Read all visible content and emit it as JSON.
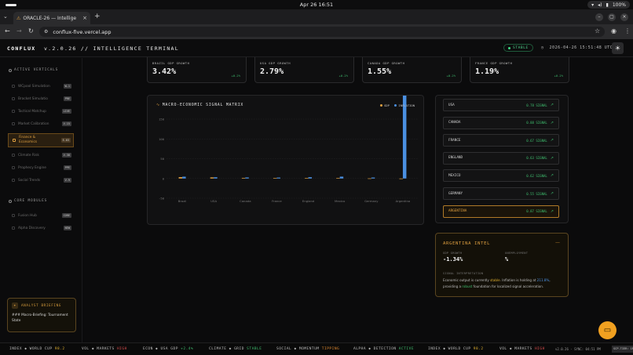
{
  "os": {
    "clock": "Apr 26  16:51",
    "battery": "100%"
  },
  "browser": {
    "tab_title": "ORACLE-26 — Intellige",
    "url": "conflux-five.vercel.app"
  },
  "header": {
    "brand": "CONFLUX",
    "version": "v.2.0.26 // INTELLIGENCE TERMINAL",
    "status": "STABLE",
    "timestamp": "2026-04-26 15:51:48 UTC"
  },
  "sidebar": {
    "active_heading": "ACTIVE VERTICALS",
    "items": [
      {
        "label": "WCpool Simulation",
        "badge": "W-1"
      },
      {
        "label": "Bracket Simulatio",
        "badge": "PRE"
      },
      {
        "label": "Tactical Matchup",
        "badge": "LIVE"
      },
      {
        "label": "Market Calibration",
        "badge": "V-15"
      },
      {
        "label": "Finance & Economics",
        "badge": "E-03",
        "active": true
      },
      {
        "label": "Climate Risk",
        "badge": "V-38"
      },
      {
        "label": "Prophecy Engine",
        "badge": "PPE"
      },
      {
        "label": "Social Trends",
        "badge": "V-9"
      }
    ],
    "modules_heading": "CORE MODULES",
    "modules": [
      {
        "label": "Fusion Hub",
        "badge": "CORE"
      },
      {
        "label": "Alpha Discovery",
        "badge": "NEW"
      }
    ],
    "briefing": {
      "title": "ANALYST BRIEFING",
      "text": "### Macro-Briefing: Tournament State"
    }
  },
  "stats": [
    {
      "label": "BRAZIL GDP GROWTH",
      "value": "3.42%",
      "delta": "+0.2%"
    },
    {
      "label": "USA GDP GROWTH",
      "value": "2.79%",
      "delta": "+0.2%"
    },
    {
      "label": "CANADA GDP GROWTH",
      "value": "1.55%",
      "delta": "+0.2%"
    },
    {
      "label": "FRANCE GDP GROWTH",
      "value": "1.19%",
      "delta": "+0.2%"
    }
  ],
  "chart_data": {
    "type": "bar",
    "title": "MACRO-ECONOMIC SIGNAL MATRIX",
    "categories": [
      "Brazil",
      "USA",
      "Canada",
      "France",
      "England",
      "Mexico",
      "Germany",
      "Argentina"
    ],
    "series": [
      {
        "name": "GDP",
        "color": "#e0a040",
        "values": [
          3.42,
          2.79,
          1.55,
          1.19,
          0.9,
          1.4,
          0.3,
          -1.34
        ]
      },
      {
        "name": "INFLATION",
        "color": "#4a90e2",
        "values": [
          4.5,
          3.1,
          2.6,
          2.3,
          3.2,
          4.6,
          2.4,
          211
        ]
      }
    ],
    "ylim": [
      -50,
      150
    ],
    "yticks": [
      "150",
      "100",
      "50",
      "0",
      "-50"
    ],
    "grid": true,
    "legend": "top-right"
  },
  "signals": [
    {
      "name": "USA",
      "value": "0.78 SIGNAL"
    },
    {
      "name": "CANADA",
      "value": "0.88 SIGNAL"
    },
    {
      "name": "FRANCE",
      "value": "0.67 SIGNAL"
    },
    {
      "name": "ENGLAND",
      "value": "0.63 SIGNAL"
    },
    {
      "name": "MEXICO",
      "value": "0.62 SIGNAL"
    },
    {
      "name": "GERMANY",
      "value": "0.55 SIGNAL"
    },
    {
      "name": "ARGENTINA",
      "value": "0.87 SIGNAL",
      "selected": true
    }
  ],
  "intel": {
    "title": "ARGENTINA INTEL",
    "gdp_label": "GDP GROWTH",
    "gdp_value": "-1.34%",
    "unemp_label": "UNEMPLOYMENT",
    "unemp_value": "%",
    "interp_label": "SIGNAL INTERPRETATION",
    "t1": "Economic output is currently ",
    "w1": "stable",
    "t2": ". Inflation is holding at ",
    "w2": "211.8%",
    "t3": ", providing a ",
    "w3": "robust",
    "t4": " foundation for localized signal acceleration."
  },
  "ticker": [
    {
      "k": "INDEX ◆ WORLD CUP",
      "v": "98.2",
      "c": "v-y"
    },
    {
      "k": "VOL ◆ MARKETS",
      "v": "HIGH",
      "c": "v-r"
    },
    {
      "k": "ECON ◆ USA GDP",
      "v": "+2.4%",
      "c": "v-g"
    },
    {
      "k": "CLIMATE ◆ GRID",
      "v": "STABLE",
      "c": "v-g"
    },
    {
      "k": "SOCIAL ◆ MOMENTUM",
      "v": "TIPPING",
      "c": "v-o"
    },
    {
      "k": "ALPHA ◆ DETECTION",
      "v": "ACTIVE",
      "c": "v-g"
    },
    {
      "k": "INDEX ◆ WORLD CUP",
      "v": "98.2",
      "c": "v-y"
    },
    {
      "k": "VOL ◆ MARKETS",
      "v": "HIGH",
      "c": "v-r"
    }
  ],
  "footer": {
    "version": "v2.0.26 · SYNC: 04:51 PM",
    "badge": "SCP-TIER: 1R"
  }
}
